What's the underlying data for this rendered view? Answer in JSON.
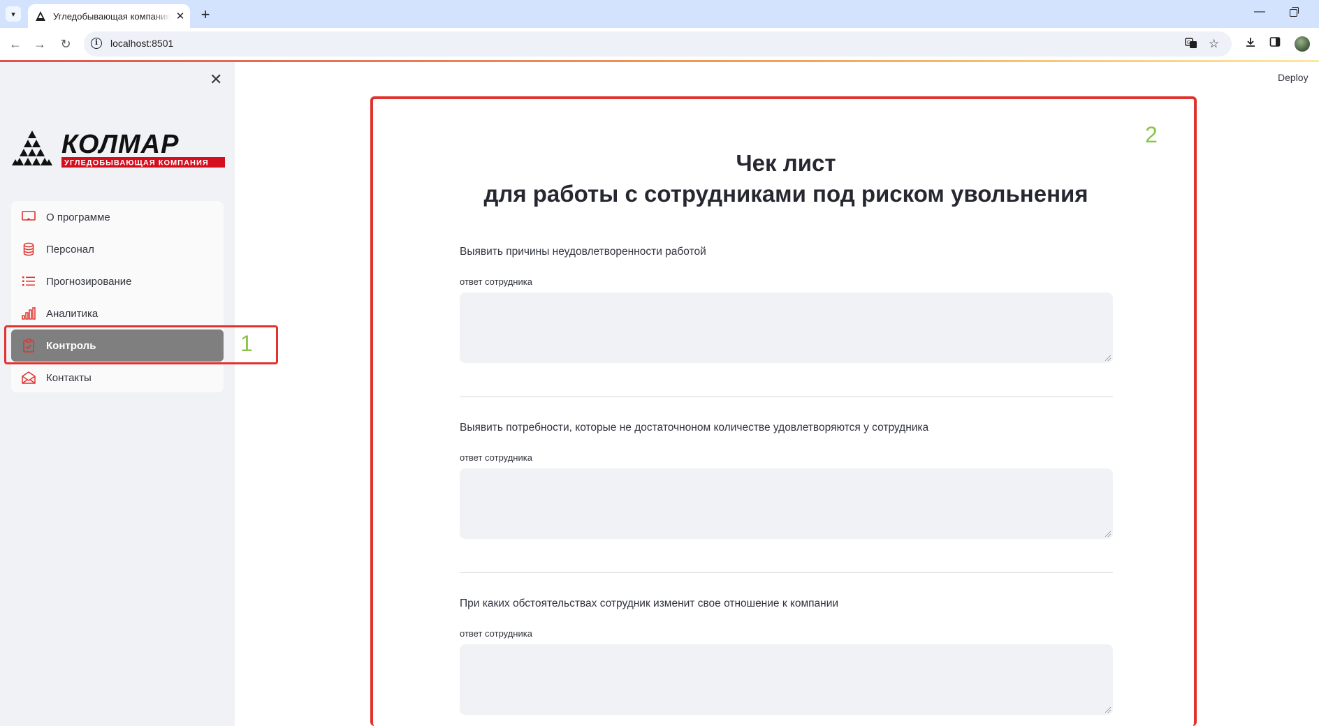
{
  "browser": {
    "tab_title": "Угледобывающая компания «Колмар»",
    "url": "localhost:8501"
  },
  "sidebar": {
    "logo_main": "КОЛМАР",
    "logo_sub": "УГЛЕДОБЫВАЮЩАЯ КОМПАНИЯ",
    "items": [
      {
        "label": "О программе",
        "icon": "monitor-icon"
      },
      {
        "label": "Персонал",
        "icon": "database-icon"
      },
      {
        "label": "Прогнозирование",
        "icon": "list-icon"
      },
      {
        "label": "Аналитика",
        "icon": "bar-chart-icon"
      },
      {
        "label": "Контроль",
        "icon": "clipboard-check-icon",
        "active": true
      },
      {
        "label": "Контакты",
        "icon": "envelope-icon"
      }
    ]
  },
  "header": {
    "deploy_label": "Deploy"
  },
  "annotations": {
    "marker_1": "1",
    "marker_2": "2"
  },
  "main": {
    "title_line1": "Чек лист",
    "title_line2": "для работы с сотрудниками под риском увольнения",
    "questions": [
      {
        "question": "Выявить причины неудовлетворенности работой",
        "field_label": "ответ сотрудника",
        "value": ""
      },
      {
        "question": "Выявить потребности, которые не достаточноном количестве удовлетворяются у сотрудника",
        "field_label": "ответ сотрудника",
        "value": ""
      },
      {
        "question": "При каких обстоятельствах сотрудник изменит свое отношение к компании",
        "field_label": "ответ сотрудника",
        "value": ""
      }
    ]
  },
  "colors": {
    "accent_red": "#e0332d",
    "marker_green": "#8bc34a",
    "active_item_bg": "#7f7f7f",
    "brand_red": "#d40e1f"
  }
}
